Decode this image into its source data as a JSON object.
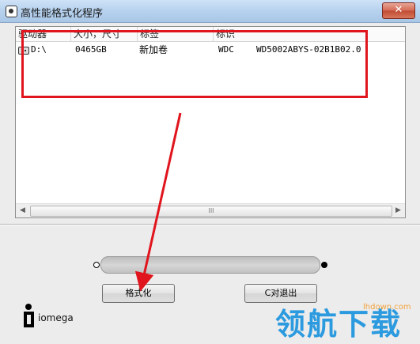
{
  "window": {
    "title": "高性能格式化程序",
    "close_label": "✕"
  },
  "drive_list": {
    "columns": [
      "驱动器",
      "大小，尺寸",
      "标签",
      "标识"
    ],
    "rows": [
      {
        "drive": "D:\\",
        "size": "0465GB",
        "label": "新加卷",
        "id": "WDC",
        "model": "WD5002ABYS-02B1B02.0"
      }
    ],
    "scroll_grip": "III"
  },
  "progress": {
    "percent": 0
  },
  "buttons": {
    "format": "格式化",
    "exit": "C对退出"
  },
  "logo": {
    "brand": "iomega"
  },
  "watermark": {
    "domain": "lhdown.com",
    "text": "领航下载"
  },
  "colors": {
    "annotation": "#e0151d",
    "watermark_text": "#2b9adf",
    "watermark_domain": "#f2a13a"
  }
}
